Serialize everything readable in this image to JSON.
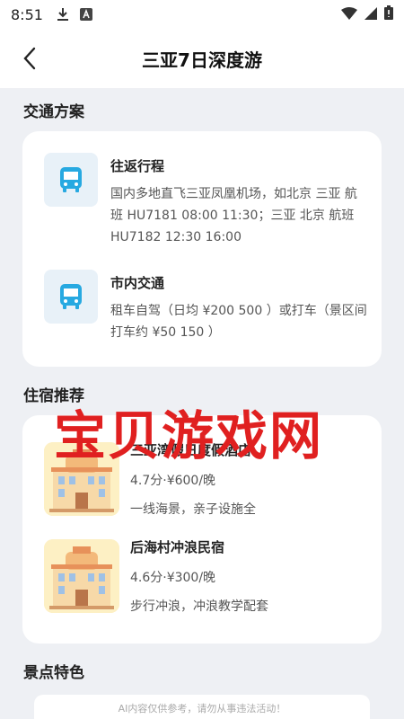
{
  "status": {
    "time": "8:51"
  },
  "nav": {
    "title": "三亚7日深度游"
  },
  "transport": {
    "section_title": "交通方案",
    "items": [
      {
        "title": "往返行程",
        "desc": "国内多地直飞三亚凤凰机场，如北京 三亚 航班 HU7181 08:00 11:30；三亚 北京 航班 HU7182 12:30 16:00"
      },
      {
        "title": "市内交通",
        "desc": "租车自驾（日均 ¥200 500 ）或打车（景区间打车约 ¥50 150 ）"
      }
    ]
  },
  "lodging": {
    "section_title": "住宿推荐",
    "items": [
      {
        "name": "三亚湾假日度假酒店",
        "meta": "4.7分·¥600/晚",
        "desc": "一线海景，亲子设施全"
      },
      {
        "name": "后海村冲浪民宿",
        "meta": "4.6分·¥300/晚",
        "desc": "步行冲浪，冲浪教学配套"
      }
    ]
  },
  "spots": {
    "section_title": "景点特色"
  },
  "watermark": "宝贝游戏网",
  "disclaimer": "AI内容仅供参考，请勿从事违法活动！",
  "colors": {
    "accent": "#27a9e1",
    "background": "#eef0f4",
    "watermark": "#e02020"
  }
}
